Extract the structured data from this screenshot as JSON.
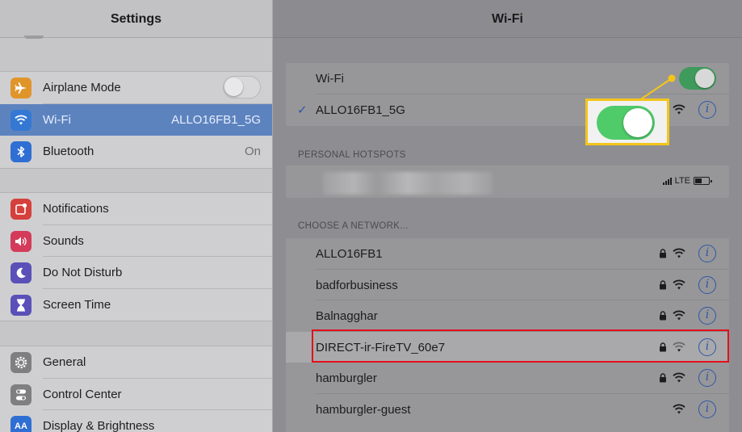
{
  "left_pane": {
    "title": "Settings",
    "group1": [
      {
        "label": "Airplane Mode",
        "icon": "airplane-icon",
        "color": "#e0952b",
        "control": "toggle-off"
      },
      {
        "label": "Wi-Fi",
        "icon": "wifi-icon",
        "color": "#3578d4",
        "value": "ALLO16FB1_5G",
        "selected": true
      },
      {
        "label": "Bluetooth",
        "icon": "bluetooth-icon",
        "color": "#2f6fd3",
        "value": "On"
      }
    ],
    "group2": [
      {
        "label": "Notifications",
        "icon": "notifications-icon",
        "color": "#d6403c"
      },
      {
        "label": "Sounds",
        "icon": "speaker-icon",
        "color": "#d43b5b"
      },
      {
        "label": "Do Not Disturb",
        "icon": "moon-icon",
        "color": "#5a50b8"
      },
      {
        "label": "Screen Time",
        "icon": "hourglass-icon",
        "color": "#5a50b8"
      }
    ],
    "group3": [
      {
        "label": "General",
        "icon": "gear-icon",
        "color": "#7f7f82"
      },
      {
        "label": "Control Center",
        "icon": "switches-icon",
        "color": "#7f7f82"
      },
      {
        "label": "Display & Brightness",
        "icon": "display-icon",
        "color": "#2f6fd3"
      }
    ]
  },
  "right_pane": {
    "title": "Wi-Fi",
    "wifi_toggle_label": "Wi-Fi",
    "wifi_enabled": true,
    "connected_network": "ALLO16FB1_5G",
    "hotspots_header": "PERSONAL HOTSPOTS",
    "hotspot_status": "LTE",
    "networks_header": "CHOOSE A NETWORK...",
    "networks": [
      {
        "name": "ALLO16FB1",
        "locked": true
      },
      {
        "name": "badforbusiness",
        "locked": true
      },
      {
        "name": "Balnagghar",
        "locked": true
      },
      {
        "name": "DIRECT-ir-FireTV_60e7",
        "locked": true,
        "highlighted": true
      },
      {
        "name": "hamburgler",
        "locked": true
      },
      {
        "name": "hamburgler-guest",
        "locked": false
      }
    ]
  },
  "colors": {
    "callout_border": "#f3c51b",
    "highlight_border": "#e3101c",
    "toggle_on": "#4fcb6a",
    "selected_row": "#5d83bf",
    "info_blue": "#2f56a6"
  },
  "info_glyph": "i",
  "check_glyph": "✓"
}
